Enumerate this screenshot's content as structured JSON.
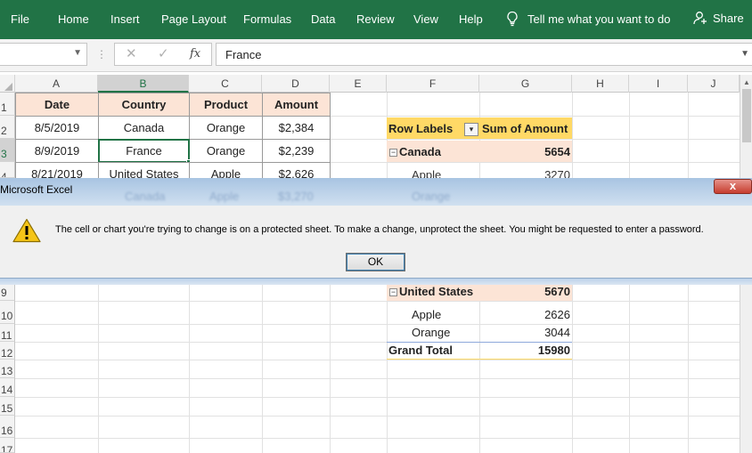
{
  "ribbon": {
    "tabs": [
      "File",
      "Home",
      "Insert",
      "Page Layout",
      "Formulas",
      "Data",
      "Review",
      "View",
      "Help"
    ],
    "tell_me": "Tell me what you want to do",
    "share": "Share"
  },
  "formula_bar": {
    "name_box": "",
    "fx_label": "fx",
    "content": "France"
  },
  "columns": [
    "A",
    "B",
    "C",
    "D",
    "E",
    "F",
    "G",
    "H",
    "I",
    "J"
  ],
  "rows": [
    "1",
    "2",
    "3",
    "4",
    "9",
    "10",
    "11",
    "12",
    "13",
    "14",
    "15",
    "16",
    "17"
  ],
  "table": {
    "headers": [
      "Date",
      "Country",
      "Product",
      "Amount"
    ],
    "rows": [
      [
        "8/5/2019",
        "Canada",
        "Orange",
        "$2,384"
      ],
      [
        "8/9/2019",
        "France",
        "Orange",
        "$2,239"
      ],
      [
        "8/21/2019",
        "United States",
        "Apple",
        "$2,626"
      ]
    ]
  },
  "pivot": {
    "header_labels": "Row Labels",
    "header_sum": "Sum of Amount",
    "canada": {
      "label": "Canada",
      "value": "5654"
    },
    "canada_apple": {
      "label": "Apple",
      "value": "3270"
    },
    "us": {
      "label": "United States",
      "value": "5670"
    },
    "us_items": [
      {
        "label": "Apple",
        "value": "2626"
      },
      {
        "label": "Orange",
        "value": "3044"
      }
    ],
    "grand_total": {
      "label": "Grand Total",
      "value": "15980"
    }
  },
  "dialog": {
    "title": "Microsoft Excel",
    "close": "x",
    "message": "The cell or chart you're trying to change is on a protected sheet. To make a change, unprotect the sheet. You might be requested to enter a password.",
    "ok": "OK",
    "ghost_row": [
      "Canada",
      "Apple",
      "$3,270",
      "Orange"
    ]
  },
  "colors": {
    "ribbon": "#217346",
    "header_fill": "#fce4d6",
    "pivot_header": "#ffd966"
  }
}
